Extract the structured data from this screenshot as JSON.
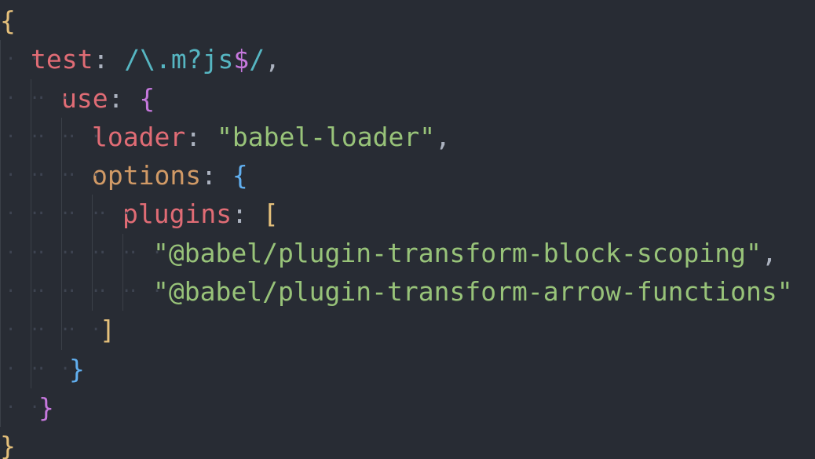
{
  "colors": {
    "background": "#282c34",
    "key": "#e06c75",
    "string": "#98c379",
    "regex": "#56b6c2",
    "bracket_gold": "#e5c07b",
    "bracket_purple": "#c678dd",
    "bracket_blue": "#61afef",
    "indent_guide": "#3b4048"
  },
  "code": {
    "l1": {
      "brace": "{"
    },
    "l2": {
      "key": "test",
      "colon": ": ",
      "regex_a": "/\\.m?js",
      "regex_dollar": "$",
      "regex_b": "/",
      "comma": ","
    },
    "l3": {
      "key": "use",
      "colon": ": ",
      "brace": "{"
    },
    "l4": {
      "key": "loader",
      "colon": ": ",
      "value": "\"babel-loader\"",
      "comma": ","
    },
    "l5": {
      "key": "options",
      "colon": ": ",
      "brace": "{"
    },
    "l6": {
      "key": "plugins",
      "colon": ": ",
      "bracket": "["
    },
    "l7": {
      "value": "\"@babel/plugin-transform-block-scoping\"",
      "comma": ","
    },
    "l8": {
      "value": "\"@babel/plugin-transform-arrow-functions\""
    },
    "l9": {
      "bracket": "]"
    },
    "l10": {
      "brace": "}"
    },
    "l11": {
      "brace": "}"
    },
    "l12": {
      "brace": "}"
    }
  }
}
